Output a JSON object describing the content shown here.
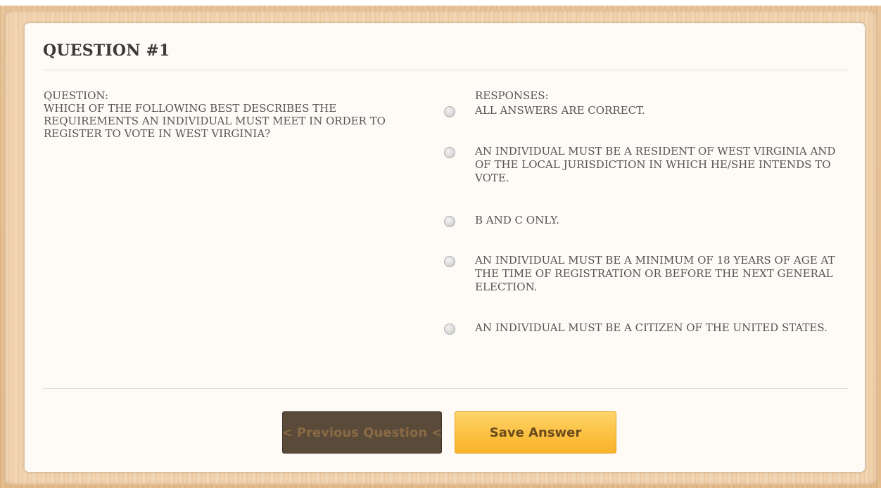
{
  "header": {
    "title": "QUESTION #1"
  },
  "question": {
    "label": "QUESTION:",
    "text": "WHICH OF THE FOLLOWING BEST DESCRIBES THE REQUIREMENTS AN INDIVIDUAL MUST MEET IN ORDER TO REGISTER TO VOTE IN WEST VIRGINIA?"
  },
  "responses": {
    "label": "RESPONSES:",
    "options": [
      {
        "text": "ALL ANSWERS ARE CORRECT."
      },
      {
        "text": "AN INDIVIDUAL MUST BE A RESIDENT OF WEST VIRGINIA AND OF THE LOCAL JURISDICTION IN WHICH HE/SHE INTENDS TO VOTE."
      },
      {
        "text": "B AND C ONLY."
      },
      {
        "text": "AN INDIVIDUAL MUST BE A MINIMUM OF 18 YEARS OF AGE AT THE TIME OF REGISTRATION OR BEFORE THE NEXT GENERAL ELECTION."
      },
      {
        "text": "AN INDIVIDUAL MUST BE A CITIZEN OF THE UNITED STATES."
      }
    ]
  },
  "buttons": {
    "previous_label": "<<< Previous Question <<<",
    "save_label": "Save Answer"
  },
  "colors": {
    "accent": "#fbbf3f",
    "previous_bg": "#5a4a3a"
  }
}
